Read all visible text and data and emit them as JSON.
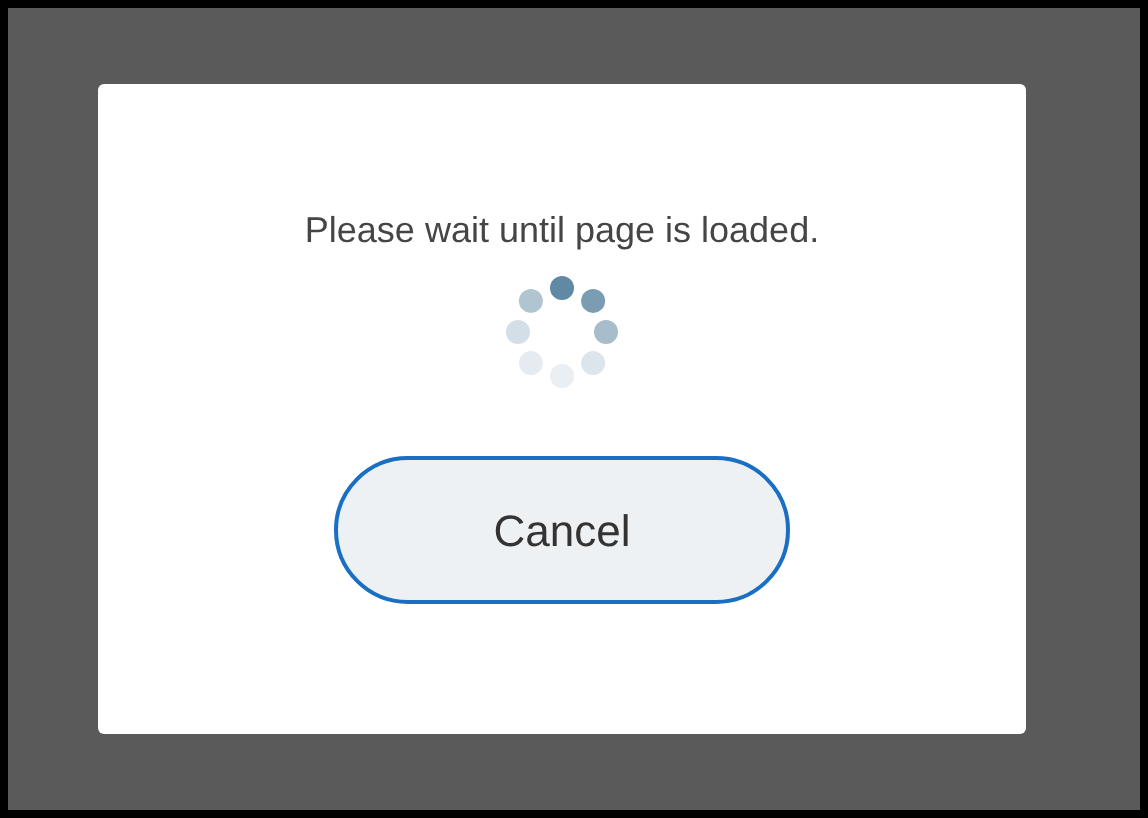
{
  "dialog": {
    "message": "Please wait until page is loaded.",
    "buttons": [
      "Cancel"
    ]
  }
}
